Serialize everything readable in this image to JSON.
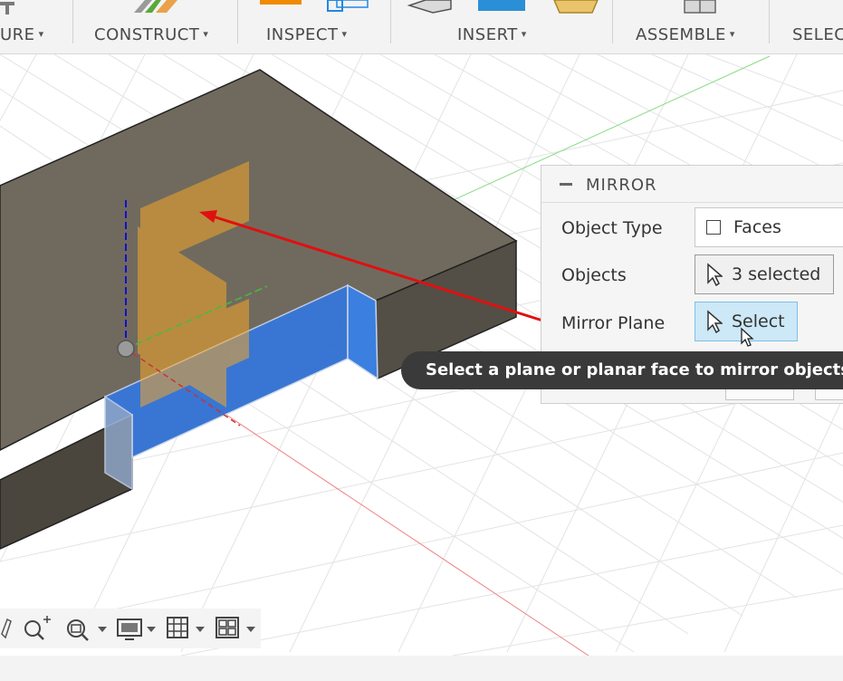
{
  "toolbar": {
    "groups": [
      {
        "label": "URE"
      },
      {
        "label": "CONSTRUCT"
      },
      {
        "label": "INSPECT"
      },
      {
        "label": "INSERT"
      },
      {
        "label": "ASSEMBLE"
      },
      {
        "label": "SELEC"
      }
    ],
    "caret": "▾"
  },
  "mirror_panel": {
    "title": "MIRROR",
    "rows": [
      {
        "label": "Object Type",
        "value": "Faces"
      },
      {
        "label": "Objects",
        "value": "3 selected"
      },
      {
        "label": "Mirror Plane",
        "value": "Select"
      }
    ]
  },
  "tooltip": {
    "text": "Select a plane or planar face to mirror objects a"
  },
  "colors": {
    "body_top": "#706a5e",
    "body_side": "#534f46",
    "selected_face": "#2f6fd1",
    "plane_orange": "#f4a62a",
    "arrow_red": "#e01010",
    "select_button": "#cde8f7"
  },
  "navbar": {
    "icons": [
      "pan-icon",
      "zoom-window-icon",
      "zoom-icon",
      "display-settings-icon",
      "grid-icon",
      "viewports-icon"
    ]
  }
}
